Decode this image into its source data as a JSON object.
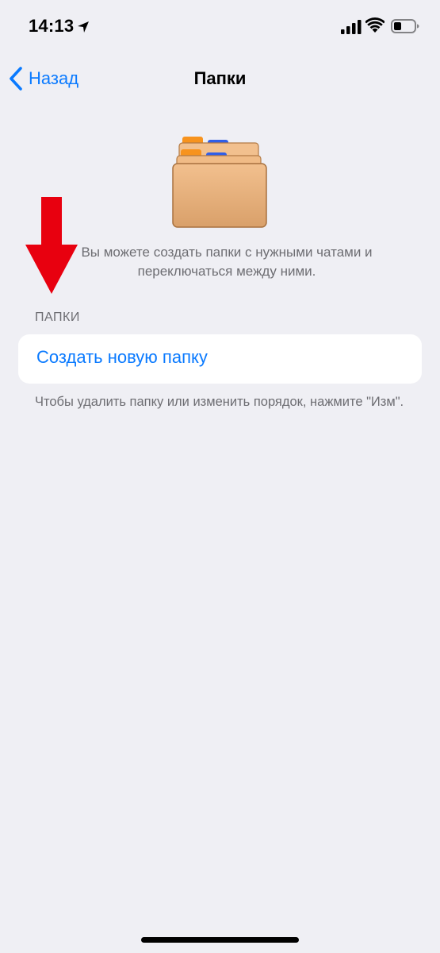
{
  "status_bar": {
    "time": "14:13",
    "icons": [
      "location-arrow-icon",
      "cellular-signal-icon",
      "wifi-icon",
      "battery-icon"
    ]
  },
  "nav": {
    "back_label": "Назад",
    "title": "Папки"
  },
  "intro": {
    "text": "Вы можете создать папки с нужными чатами и переключаться между ними."
  },
  "folders_section": {
    "header": "ПАПКИ",
    "items": [
      {
        "label": "Создать новую папку"
      }
    ],
    "footer": "Чтобы удалить папку или изменить порядок, нажмите \"Изм\"."
  },
  "colors": {
    "accent": "#0a7aff",
    "background": "#efeff4",
    "secondary_text": "#6d6d72",
    "arrow": "#e8000f"
  }
}
